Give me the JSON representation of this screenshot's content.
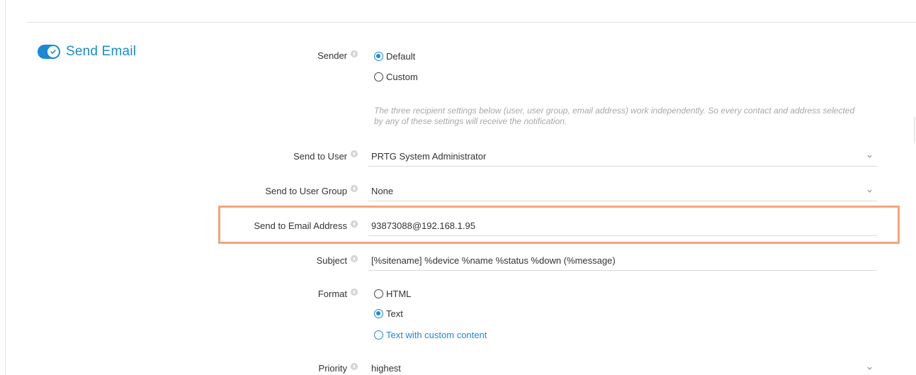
{
  "section": {
    "title": "Send Email",
    "enabled": true
  },
  "sender": {
    "label": "Sender",
    "options": [
      {
        "label": "Default",
        "selected": true
      },
      {
        "label": "Custom",
        "selected": false
      }
    ]
  },
  "help_text": "The three recipient settings below (user, user group, email address) work independently. So every contact and address selected by any of these settings will receive the notification.",
  "send_to_user": {
    "label": "Send to User",
    "value": "PRTG System Administrator"
  },
  "send_to_user_group": {
    "label": "Send to User Group",
    "value": "None"
  },
  "send_to_email": {
    "label": "Send to Email Address",
    "value": "93873088@192.168.1.95"
  },
  "subject": {
    "label": "Subject",
    "value": "[%sitename] %device %name %status %down (%message)"
  },
  "format": {
    "label": "Format",
    "options": [
      {
        "label": "HTML",
        "selected": false
      },
      {
        "label": "Text",
        "selected": true
      },
      {
        "label": "Text with custom content",
        "selected": false
      }
    ]
  },
  "priority": {
    "label": "Priority",
    "value": "highest"
  },
  "colors": {
    "accent": "#1a8ad4",
    "highlight": "#f2a579"
  }
}
